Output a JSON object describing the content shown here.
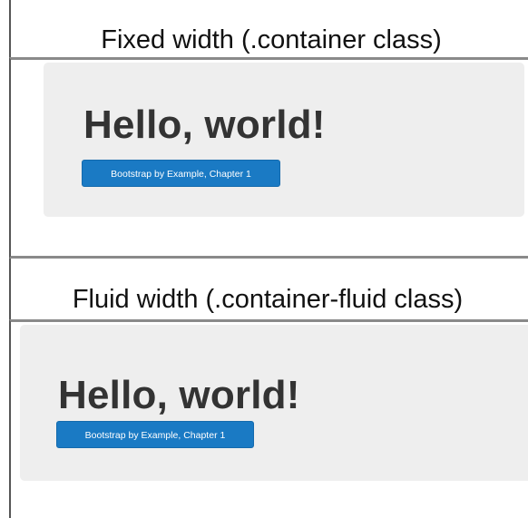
{
  "sections": {
    "fixed": {
      "caption": "Fixed width (.container class)",
      "heading": "Hello, world!",
      "button_label": "Bootstrap by Example, Chapter 1"
    },
    "fluid": {
      "caption": "Fluid width (.container-fluid class)",
      "heading": "Hello, world!",
      "button_label": "Bootstrap by Example, Chapter 1"
    }
  },
  "colors": {
    "jumbotron_bg": "#eeeeee",
    "button_primary": "#1a7ac4",
    "heading_text": "#333333"
  }
}
